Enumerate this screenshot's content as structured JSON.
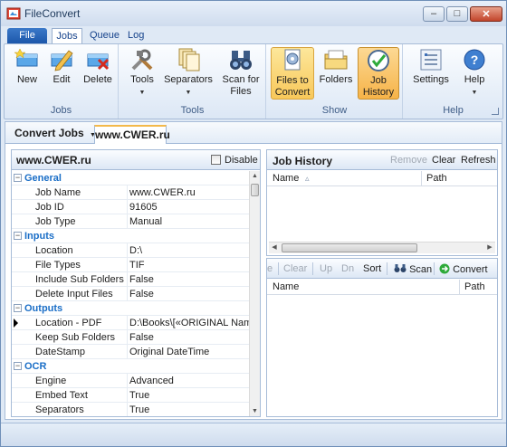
{
  "window": {
    "title": "FileConvert",
    "minimize": "–",
    "maximize": "□",
    "close": "✕"
  },
  "ribbon_tabs": [
    "File",
    "Jobs",
    "Queue",
    "Log"
  ],
  "ribbon": {
    "groups": [
      {
        "label": "Jobs",
        "buttons": [
          "New",
          "Edit",
          "Delete"
        ]
      },
      {
        "label": "Tools",
        "buttons": [
          "Tools",
          "Separators",
          "Scan for\nFiles"
        ]
      },
      {
        "label": "Show",
        "buttons": [
          "Files to\nConvert",
          "Folders",
          "Job\nHistory"
        ]
      },
      {
        "label": "Help",
        "buttons": [
          "Settings",
          "Help"
        ]
      }
    ],
    "labels": {
      "new": "New",
      "edit": "Edit",
      "delete": "Delete",
      "tools": "Tools",
      "separators": "Separators",
      "scan1": "Scan for",
      "scan2": "Files",
      "ftc1": "Files to",
      "ftc2": "Convert",
      "folders": "Folders",
      "jh1": "Job",
      "jh2": "History",
      "settings": "Settings",
      "help": "Help",
      "grp_jobs": "Jobs",
      "grp_tools": "Tools",
      "grp_show": "Show",
      "grp_help": "Help"
    }
  },
  "doc": {
    "section_title": "Convert Jobs",
    "active_tab": "www.CWER.ru"
  },
  "properties": {
    "title": "www.CWER.ru",
    "disable_label": "Disable",
    "rows": [
      {
        "type": "cat",
        "name": "General"
      },
      {
        "type": "prop",
        "name": "Job Name",
        "value": "www.CWER.ru"
      },
      {
        "type": "prop",
        "name": "Job ID",
        "value": "91605"
      },
      {
        "type": "prop",
        "name": "Job Type",
        "value": "Manual"
      },
      {
        "type": "cat",
        "name": "Inputs"
      },
      {
        "type": "prop",
        "name": "Location",
        "value": "D:\\"
      },
      {
        "type": "prop",
        "name": "File Types",
        "value": "TIF"
      },
      {
        "type": "prop",
        "name": "Include Sub Folders",
        "value": "False"
      },
      {
        "type": "prop",
        "name": "Delete Input Files",
        "value": "False"
      },
      {
        "type": "cat",
        "name": "Outputs"
      },
      {
        "type": "prop",
        "name": "Location - PDF",
        "value": "D:\\Books\\[«ORIGINAL Name»",
        "selected": true
      },
      {
        "type": "prop",
        "name": "Keep Sub Folders",
        "value": "False"
      },
      {
        "type": "prop",
        "name": "DateStamp",
        "value": "Original DateTime"
      },
      {
        "type": "cat",
        "name": "OCR"
      },
      {
        "type": "prop",
        "name": "Engine",
        "value": "Advanced"
      },
      {
        "type": "prop",
        "name": "Embed Text",
        "value": "True"
      },
      {
        "type": "prop",
        "name": "Separators",
        "value": "True"
      }
    ]
  },
  "job_history": {
    "title": "Job History",
    "actions": {
      "remove": "Remove",
      "clear": "Clear",
      "refresh": "Refresh"
    },
    "columns": {
      "name": "Name",
      "sort": "▵",
      "path": "Path"
    }
  },
  "files": {
    "toolbar": {
      "e": "e",
      "clear": "Clear",
      "up": "Up",
      "dn": "Dn",
      "sort": "Sort",
      "scan": "Scan",
      "convert": "Convert"
    },
    "columns": {
      "name": "Name",
      "path": "Path"
    }
  }
}
